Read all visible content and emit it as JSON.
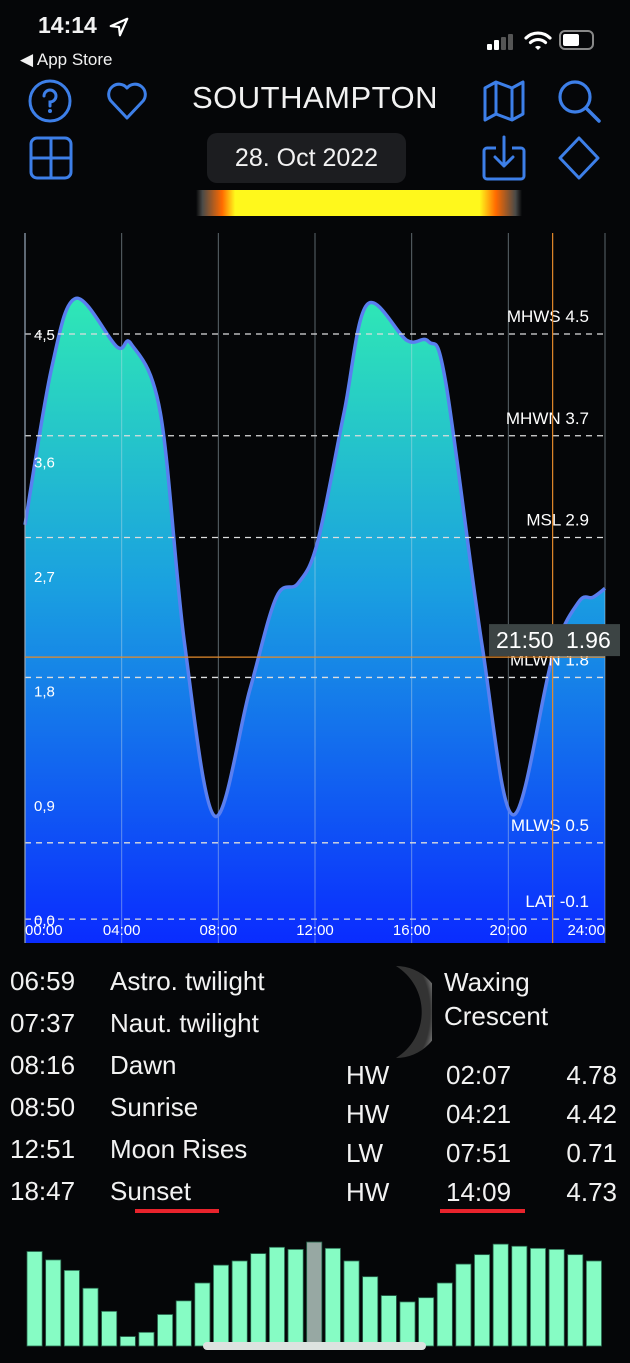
{
  "status_bar": {
    "time": "14:14",
    "back_label": "◀ App Store"
  },
  "header": {
    "title": "SOUTHAMPTON",
    "date": "28. Oct 2022",
    "icons": [
      "help-icon",
      "heart-icon",
      "map-icon",
      "search-icon",
      "grid-icon",
      "download-icon",
      "diamond-icon"
    ],
    "accent_color": "#3d7fe8"
  },
  "chart_data": {
    "type": "area",
    "x_unit": "hours",
    "xlim": [
      0,
      24
    ],
    "ylim": [
      -0.2,
      5.1
    ],
    "x_ticks": [
      "00:00",
      "04:00",
      "08:00",
      "12:00",
      "16:00",
      "20:00",
      "24:00"
    ],
    "y_ticks": [
      "0,0",
      "0,9",
      "1,8",
      "2,7",
      "3,6",
      "4,5"
    ],
    "y_tick_values": [
      0,
      0.9,
      1.8,
      2.7,
      3.6,
      4.5
    ],
    "reference_lines": [
      {
        "label": "MHWS 4.5",
        "value": 4.5
      },
      {
        "label": "MHWN 3.7",
        "value": 3.7
      },
      {
        "label": "MSL 2.9",
        "value": 2.9
      },
      {
        "label": "MLWN 1.8",
        "value": 1.8
      },
      {
        "label": "MLWS 0.5",
        "value": 0.5
      },
      {
        "label": "LAT -0.1",
        "value": -0.1
      }
    ],
    "x": [
      0,
      1.1,
      2.1,
      3.8,
      4.4,
      5.6,
      6.6,
      7.85,
      9.3,
      10.4,
      11.3,
      12.1,
      13.2,
      14.15,
      15.8,
      16.7,
      17.4,
      18.9,
      20.2,
      21.83,
      22.9,
      23.5,
      24
    ],
    "y": [
      3.0,
      4.23,
      4.78,
      4.4,
      4.42,
      3.88,
      2.07,
      0.71,
      1.7,
      2.43,
      2.54,
      2.86,
      3.88,
      4.73,
      4.45,
      4.44,
      4.13,
      2.07,
      0.72,
      1.96,
      2.39,
      2.43,
      2.5
    ],
    "cursor": {
      "time": "21:50",
      "value": "1.96",
      "x": 21.8333,
      "y": 1.96
    },
    "colors": {
      "fill_top": "#2fe8b5",
      "fill_bottom": "#0a2cff",
      "line": "#5a7ff0",
      "cursor": "#e58a2a"
    }
  },
  "events": [
    {
      "time": "06:59",
      "label": "Astro. twilight"
    },
    {
      "time": "07:37",
      "label": "Naut. twilight"
    },
    {
      "time": "08:16",
      "label": "Dawn"
    },
    {
      "time": "08:50",
      "label": "Sunrise"
    },
    {
      "time": "12:51",
      "label": "Moon Rises"
    },
    {
      "time": "18:47",
      "label": "Sunset"
    }
  ],
  "moon": {
    "phase_line1": "Waxing",
    "phase_line2": "Crescent"
  },
  "tides": [
    {
      "type": "HW",
      "time": "02:07",
      "height": "4.78"
    },
    {
      "type": "HW",
      "time": "04:21",
      "height": "4.42"
    },
    {
      "type": "LW",
      "time": "07:51",
      "height": "0.71"
    },
    {
      "type": "HW",
      "time": "14:09",
      "height": "4.73"
    }
  ],
  "bars": {
    "values": [
      90,
      82,
      72,
      55,
      33,
      9,
      13,
      30,
      43,
      60,
      77,
      81,
      88,
      94,
      92,
      99,
      93,
      81,
      66,
      48,
      42,
      46,
      60,
      78,
      87,
      97,
      95,
      93,
      92,
      87,
      81
    ],
    "highlight_index": 15,
    "color": "#86fcc4",
    "highlight_color": "#97a8a3"
  }
}
